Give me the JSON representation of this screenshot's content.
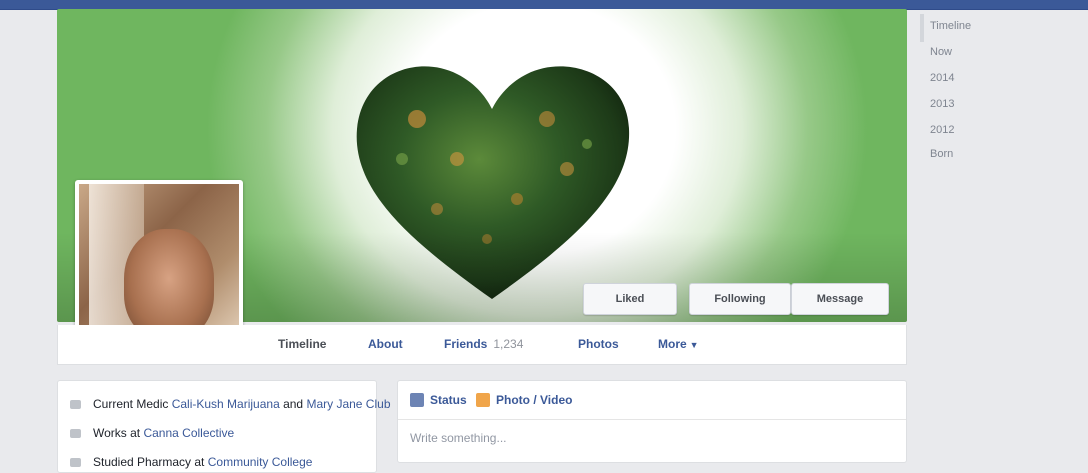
{
  "cover": {
    "buttons": [
      "Liked",
      "Following",
      "Message"
    ]
  },
  "profile_tabs": [
    {
      "label": "Timeline",
      "count": "",
      "active": true
    },
    {
      "label": "About",
      "count": "",
      "active": false
    },
    {
      "label": "Friends",
      "count": "1,234",
      "active": false
    },
    {
      "label": "Photos",
      "count": "",
      "active": false
    },
    {
      "label": "More",
      "count": "",
      "active": false
    }
  ],
  "about": {
    "rows": [
      {
        "prefix": "Current Medic",
        "link": "Cali-Kush Marijuana",
        "middle": " and ",
        "link2": "Mary Jane Club"
      },
      {
        "prefix": "Works at ",
        "link": "Canna Collective",
        "middle": "",
        "link2": ""
      },
      {
        "prefix": "Studied Pharmacy at ",
        "link": "Community College",
        "middle": "",
        "link2": ""
      }
    ]
  },
  "composer": {
    "status_label": "Status",
    "photo_label": "Photo / Video",
    "placeholder": "Write something..."
  },
  "sidebar": {
    "items": [
      "Timeline",
      "Now",
      "2014",
      "2013",
      "2012",
      "Born"
    ]
  },
  "colors": {
    "facebook_blue": "#3b5998",
    "cover_green": "#6fb65f",
    "page_bg": "#e9eaed"
  }
}
